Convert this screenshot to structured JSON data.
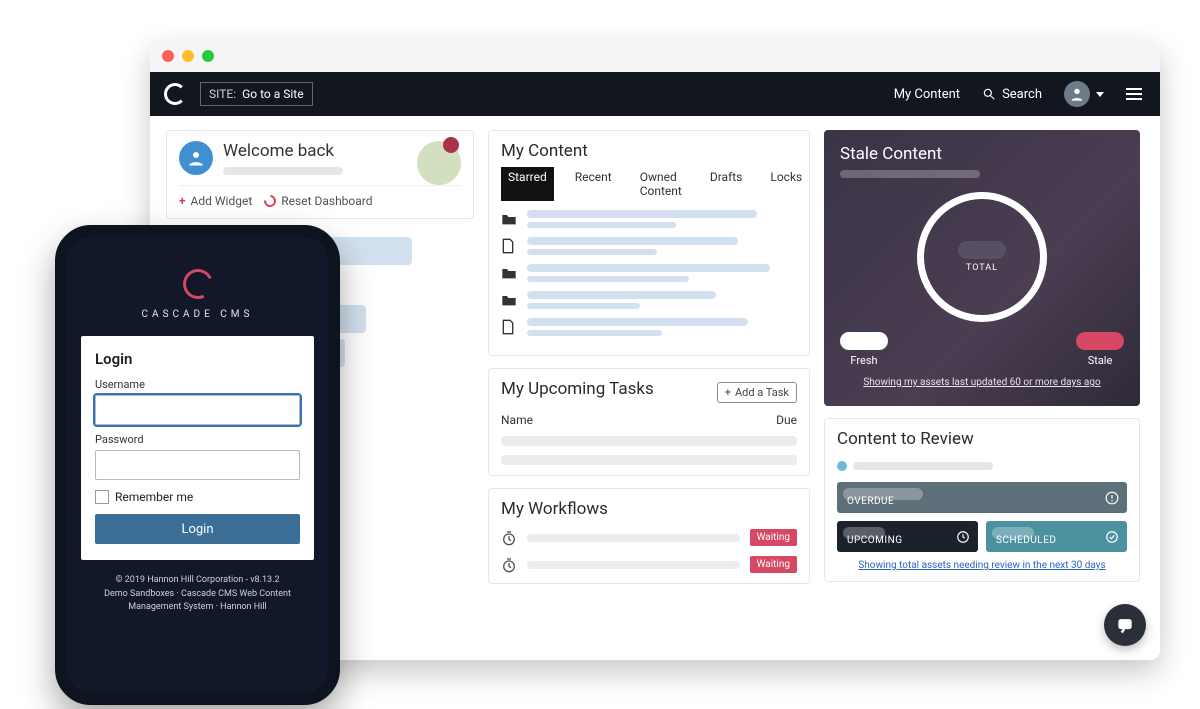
{
  "header": {
    "site_label": "SITE:",
    "site_picker": "Go to a Site",
    "my_content": "My Content",
    "search": "Search"
  },
  "welcome": {
    "title": "Welcome back",
    "add_widget": "Add Widget",
    "reset_dashboard": "Reset Dashboard"
  },
  "my_content": {
    "title": "My Content",
    "tabs": [
      "Starred",
      "Recent",
      "Owned Content",
      "Drafts",
      "Locks"
    ],
    "active_tab": 0,
    "row_icons": [
      "folder",
      "file",
      "folder",
      "folder",
      "file"
    ]
  },
  "tasks": {
    "title": "My Upcoming Tasks",
    "add_button": "Add a Task",
    "col_name": "Name",
    "col_due": "Due"
  },
  "workflows": {
    "title": "My Workflows",
    "status_label": "Waiting"
  },
  "stale": {
    "title": "Stale Content",
    "total_label": "TOTAL",
    "fresh_label": "Fresh",
    "stale_label": "Stale",
    "footer": "Showing my assets last updated 60 or more days ago"
  },
  "review": {
    "title": "Content to Review",
    "overdue": "OVERDUE",
    "upcoming": "UPCOMING",
    "scheduled": "SCHEDULED",
    "footer": "Showing total assets needing review in the next 30 days"
  },
  "phone": {
    "brand": "CASCADE CMS",
    "login_title": "Login",
    "username_label": "Username",
    "password_label": "Password",
    "remember_label": "Remember me",
    "login_button": "Login",
    "footer_line1": "© 2019 Hannon Hill Corporation - v8.13.2",
    "footer_line2": "Demo Sandboxes · Cascade CMS Web Content Management System · Hannon Hill"
  }
}
